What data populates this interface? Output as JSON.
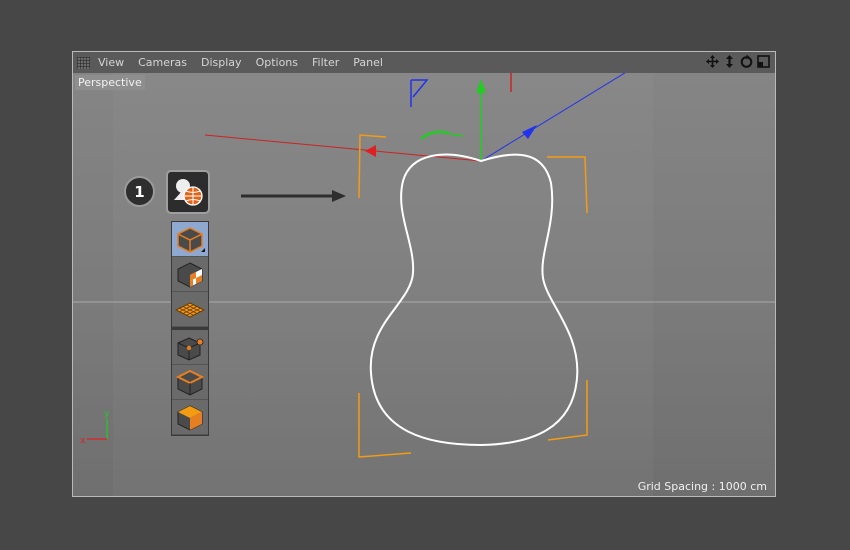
{
  "menubar": {
    "items": [
      "View",
      "Cameras",
      "Display",
      "Options",
      "Filter",
      "Panel"
    ],
    "nav_icons": [
      "move-icon",
      "zoom-icon",
      "rotate-icon",
      "maximize-icon"
    ]
  },
  "viewport": {
    "camera_label": "Perspective",
    "grid_spacing_label": "Grid Spacing : 1000 cm",
    "axis_labels": {
      "y": "y",
      "x": "x"
    }
  },
  "annotation": {
    "step_number": "1"
  },
  "tool_palette": {
    "main_tool": "mode-tool-icon",
    "tools": [
      "object-mode-icon",
      "texture-mode-icon",
      "workplane-mode-icon",
      "points-mode-icon",
      "edges-mode-icon",
      "polygons-mode-icon"
    ]
  },
  "colors": {
    "background": "#474747",
    "spline": "#ffffff",
    "bounding_box": "#f39c12",
    "axis_x": "#e02020",
    "axis_y": "#22cc22",
    "axis_z": "#2233ee"
  }
}
